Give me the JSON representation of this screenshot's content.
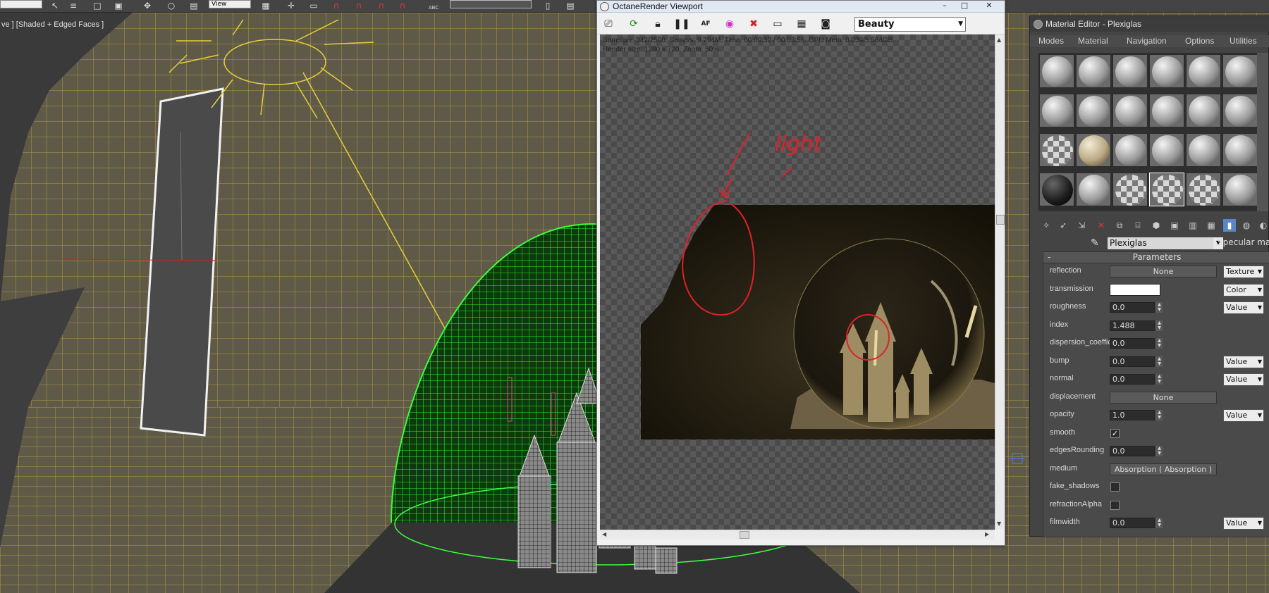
{
  "viewport": {
    "label": "ve ] [Shaded + Edged Faces ]"
  },
  "toolbar": {
    "view_dropdown": "View",
    "abc_label": "ABC"
  },
  "octane": {
    "title": "OctaneRender Viewport",
    "pass_select": "Beauty",
    "stats_line1": "Samp/pix: 342/2500.   Samp/s: 9.794M.   Time: 00:00:32 / 00:03:56.   GPU Mem: 0.039/5.564GB.",
    "stats_line2": "Render size: 1280 x 720.   Zoom: 50%.",
    "annotation_text": "light",
    "icons": [
      "camera-view-icon",
      "refresh-icon",
      "lock-icon",
      "pause-icon",
      "af-icon",
      "color-picker-icon",
      "clear-icon",
      "settings-icon",
      "frame-icon",
      "camera-save-icon"
    ],
    "window_controls": [
      "–",
      "□",
      "✕"
    ]
  },
  "material_editor": {
    "title": "Material Editor - Plexiglas",
    "menus": [
      "Modes",
      "Material",
      "Navigation",
      "Options",
      "Utilities"
    ],
    "material_name": "Plexiglas",
    "material_type": "Specular materi",
    "parameters_header": "Parameters",
    "parameters_collapse": "-",
    "params": [
      {
        "label": "reflection",
        "kind": "button",
        "value": "None",
        "select": "Texture"
      },
      {
        "label": "transmission",
        "kind": "color",
        "value": "",
        "select": "Color"
      },
      {
        "label": "roughness",
        "kind": "spinner",
        "value": "0.0",
        "select": "Value"
      },
      {
        "label": "index",
        "kind": "spinner",
        "value": "1.488",
        "select": ""
      },
      {
        "label": "dispersion_coeffic",
        "kind": "spinner",
        "value": "0.0",
        "select": ""
      },
      {
        "label": "bump",
        "kind": "spinner",
        "value": "0.0",
        "select": "Value"
      },
      {
        "label": "normal",
        "kind": "spinner",
        "value": "0.0",
        "select": "Value"
      },
      {
        "label": "displacement",
        "kind": "button",
        "value": "None",
        "select": ""
      },
      {
        "label": "opacity",
        "kind": "spinner",
        "value": "1.0",
        "select": "Value"
      },
      {
        "label": "smooth",
        "kind": "check",
        "value": "✓",
        "select": ""
      },
      {
        "label": "edgesRounding",
        "kind": "spinner",
        "value": "0.0",
        "select": ""
      },
      {
        "label": "medium",
        "kind": "button",
        "value": "Absorption  ( Absorption )",
        "select": ""
      },
      {
        "label": "fake_shadows",
        "kind": "check",
        "value": "",
        "select": ""
      },
      {
        "label": "refractionAlpha",
        "kind": "check",
        "value": "",
        "select": ""
      },
      {
        "label": "filmwidth",
        "kind": "spinner",
        "value": "0.0",
        "select": "Value"
      }
    ]
  }
}
